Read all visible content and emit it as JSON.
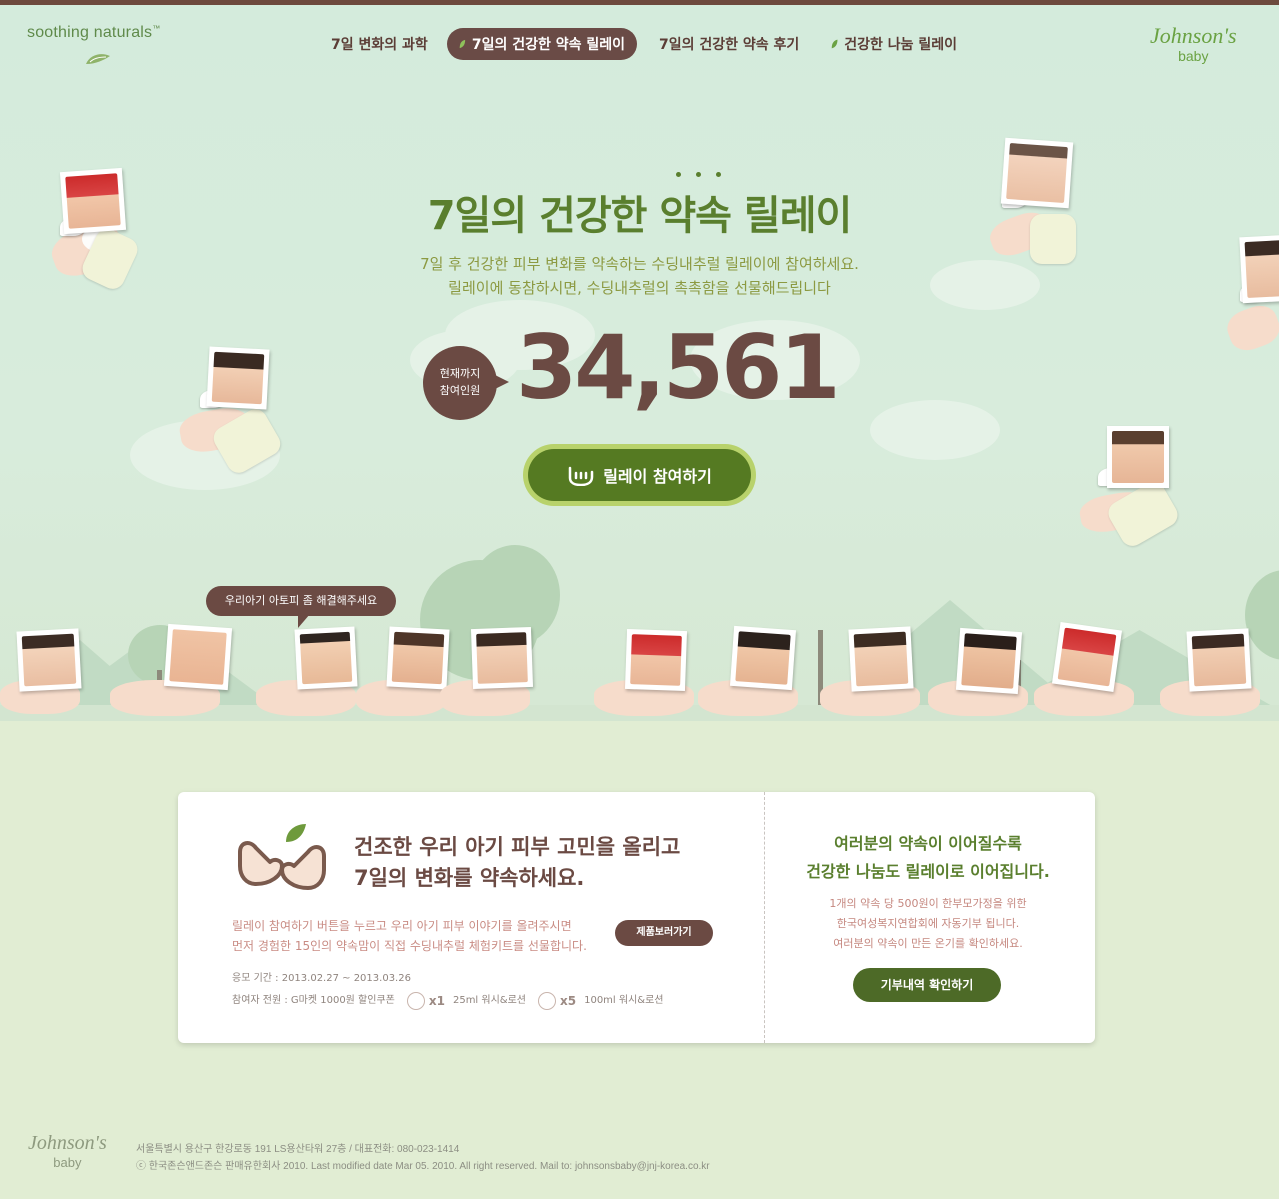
{
  "header": {
    "logo_left": "soothing naturals",
    "logo_left_tm": "™",
    "logo_right_top": "Johnson's",
    "logo_right_bottom": "baby",
    "nav": [
      {
        "label": "7일 변화의 과학",
        "active": false
      },
      {
        "label": "7일의 건강한 약속 릴레이",
        "active": true
      },
      {
        "label": "7일의 건강한 약속 후기",
        "active": false
      },
      {
        "label": "건강한 나눔 릴레이",
        "active": false
      }
    ]
  },
  "hero": {
    "title": "7일의 건강한 약속 릴레이",
    "subtitle_line1": "7일 후 건강한 피부 변화를 약속하는 수딩내추럴 릴레이에 참여하세요.",
    "subtitle_line2": "릴레이에 동참하시면, 수딩내추럴의 촉촉함을 선물해드립니다",
    "count_label_line1": "현재까지",
    "count_label_line2": "참여인원",
    "count": "34,561",
    "join_button": "릴레이 참여하기"
  },
  "relay": {
    "speech_bubble": "우리아기 아토피 좀 해결해주세요"
  },
  "info": {
    "left_heading_line1": "건조한 우리 아기 피부 고민을 올리고",
    "left_heading_line2": "7일의 변화를 약속하세요.",
    "left_text_line1": "릴레이 참여하기 버튼을 누르고 우리 아기 피부 이야기를 올려주시면",
    "left_text_line2": "먼저 경험한 15인의 약속맘이 직접 수딩내추럴 체험키트를 선물합니다.",
    "product_button": "제품보러가기",
    "period": "응모 기간 : 2013.02.27 ~ 2013.03.26",
    "participants": "참여자 전원 : G마켓 1000원 할인쿠폰",
    "prize1_qty": "x1",
    "prize1_label": "25ml 워시&로션",
    "prize2_qty": "x5",
    "prize2_label": "100ml 워시&로션",
    "right_heading_line1": "여러분의 약속이 이어질수록",
    "right_heading_line2": "건강한 나눔도 릴레이로 이어집니다.",
    "right_text_line1": "1개의 약속 당 500원이 한부모가정을 위한",
    "right_text_line2": "한국여성복지연합회에 자동기부 됩니다.",
    "right_text_line3": "여러분의 약속이 만든 온기를 확인하세요.",
    "donate_button": "기부내역 확인하기"
  },
  "footer": {
    "logo_top": "Johnson's",
    "logo_bottom": "baby",
    "address": "서울특별시 용산구 한강로동 191 LS용산타워 27층 / 대표전화: 080-023-1414",
    "copyright": "ⓒ 한국존슨앤드존슨 판매유한회사 2010. Last modified date Mar 05. 2010. All right reserved. Mail to: johnsonsbaby@jnj-korea.co.kr"
  },
  "colors": {
    "brand_brown": "#6b4a43",
    "brand_green": "#5a7f2e",
    "button_green": "#557a22"
  }
}
